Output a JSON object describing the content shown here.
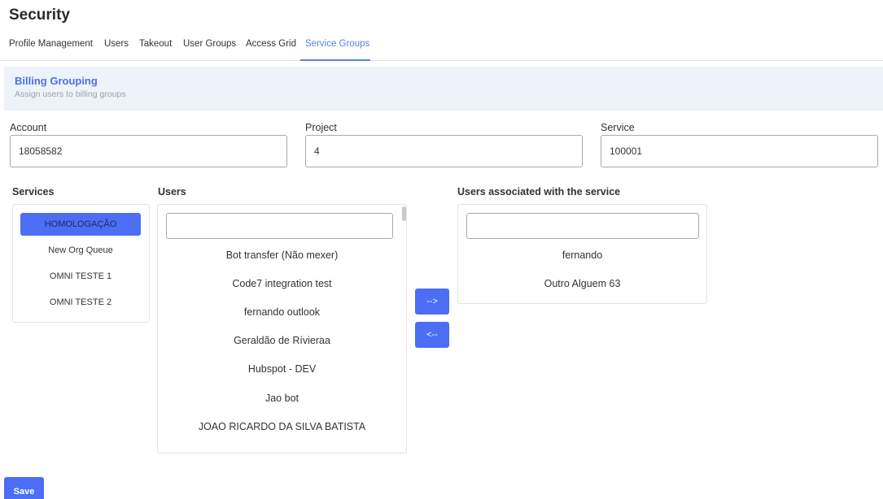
{
  "page": {
    "title": "Security"
  },
  "tabs": [
    {
      "label": "Profile Management"
    },
    {
      "label": "Users"
    },
    {
      "label": "Takeout"
    },
    {
      "label": "User Groups"
    },
    {
      "label": "Access Grid"
    },
    {
      "label": "Service Groups",
      "active": true
    }
  ],
  "banner": {
    "title": "Billing Grouping",
    "subtitle": "Assign users to billing groups"
  },
  "fields": {
    "account": {
      "label": "Account",
      "value": "18058582"
    },
    "project": {
      "label": "Project",
      "value": "4"
    },
    "service": {
      "label": "Service",
      "value": "100001"
    }
  },
  "services": {
    "label": "Services",
    "items": [
      "HOMOLOGAÇÃO",
      "New Org Queue",
      "OMNI TESTE 1",
      "OMNI TESTE 2"
    ],
    "selected": "HOMOLOGAÇÃO"
  },
  "users": {
    "label": "Users",
    "search_value": "",
    "items": [
      "Bot transfer (Não mexer)",
      "Code7 integration test",
      "fernando outlook",
      "Geraldão de Rívieraa",
      "Hubspot - DEV",
      "Jao bot",
      "JOAO RICARDO DA SILVA BATISTA"
    ]
  },
  "associated": {
    "label": "Users associated with the service",
    "search_value": "",
    "items": [
      "fernando",
      "Outro Alguem 63"
    ]
  },
  "actions": {
    "add_label": "-->",
    "remove_label": "<--",
    "save_label": "Save"
  },
  "colors": {
    "accent": "#4c6ef5",
    "tab_active": "#5b7ee5",
    "banner_bg": "#eef3f9"
  }
}
